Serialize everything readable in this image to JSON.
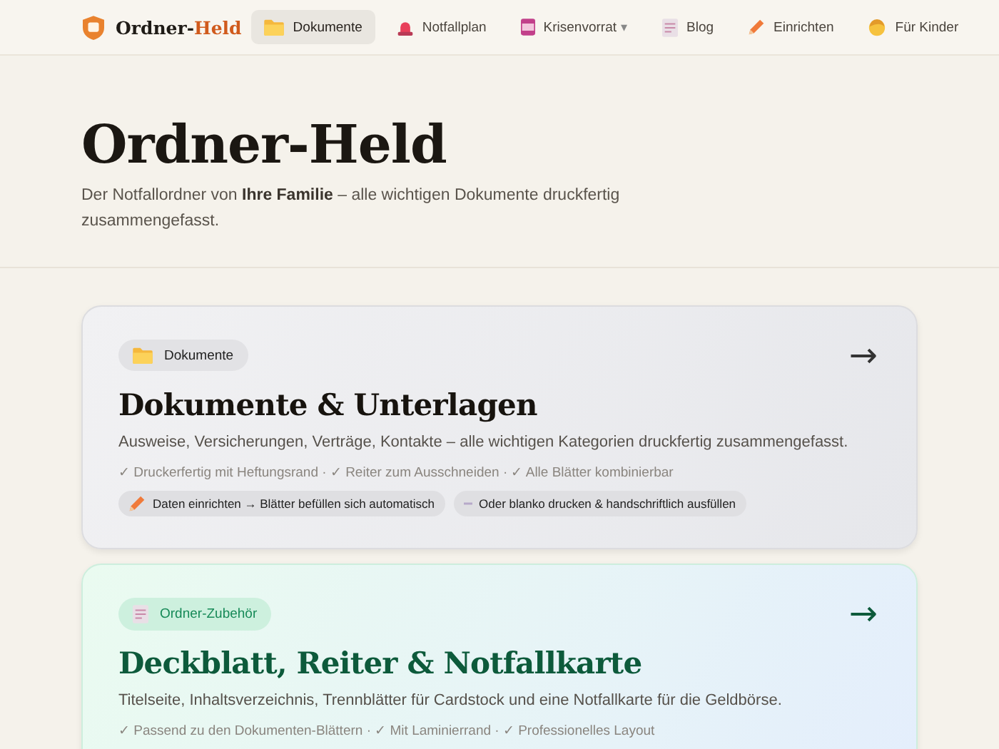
{
  "brand": {
    "name_part_1": "Ordner-",
    "name_part_2": "Held"
  },
  "nav": [
    {
      "label": "Dokumente",
      "kind": "folder",
      "selected": true,
      "dropdown": false
    },
    {
      "label": "Notfallplan",
      "kind": "siren",
      "selected": false,
      "dropdown": false
    },
    {
      "label": "Krisenvorrat",
      "kind": "can",
      "selected": false,
      "dropdown": true,
      "caret": "▾"
    },
    {
      "label": "Blog",
      "kind": "memo",
      "selected": false,
      "dropdown": false
    },
    {
      "label": "Einrichten",
      "kind": "pencil",
      "selected": false,
      "dropdown": false
    },
    {
      "label": "Für Kinder",
      "kind": "child",
      "selected": false,
      "dropdown": false
    }
  ],
  "hero": {
    "title": "Ordner-Held",
    "subtitle": "Der Notfallordner von **Ihre Familie** – alle wichtigen Dokumente druckfertig zusammengefasst."
  },
  "cards": [
    {
      "kind": "grey",
      "tag": {
        "label": "Dokumente",
        "kind": "folder"
      },
      "arrow": "→",
      "title": "Dokumente & Unterlagen",
      "description": "Ausweise, Versicherungen, Verträge, Kontakte – alle wichtigen Kategorien druckfertig zusammengefasst.",
      "features": "✓ Druckerfertig mit Heftungsrand · ✓ Reiter zum Ausschneiden · ✓ Alle Blätter kombinierbar",
      "chips": [
        {
          "label": "Daten einrichten → Blätter befüllen sich automatisch",
          "kind": "pencil"
        },
        {
          "label": "Oder blanko drucken & handschriftlich ausfüllen",
          "kind": "dash"
        }
      ]
    },
    {
      "kind": "green",
      "tag": {
        "label": "Ordner-Zubehör",
        "kind": "memo"
      },
      "arrow": "→",
      "title": "Deckblatt, Reiter & Notfallkarte",
      "description": "Titelseite, Inhaltsverzeichnis, Trennblätter für Cardstock und eine Notfallkarte für die Geldbörse.",
      "features": "✓ Passend zu den Dokumenten-Blättern · ✓ Mit Laminierrand · ✓ Professionelles Layout"
    }
  ]
}
